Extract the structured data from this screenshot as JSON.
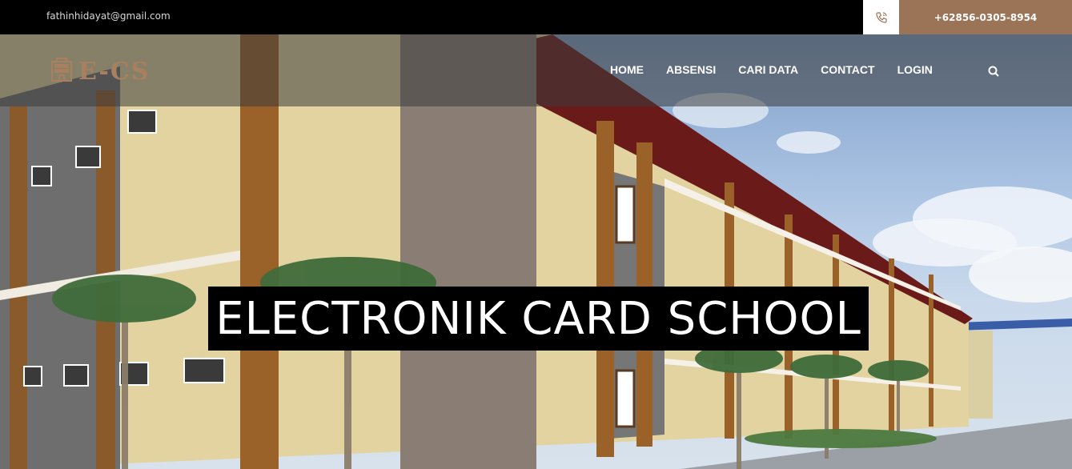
{
  "topbar": {
    "email": "fathinhidayat@gmail.com",
    "phone": "+62856-0305-8954",
    "phone_icon": "phone-icon"
  },
  "brand": {
    "logo_text": "E-CS",
    "logo_icon": "building-icon",
    "color": "#a9805f"
  },
  "nav": {
    "items": [
      "HOME",
      "ABSENSI",
      "CARI DATA",
      "CONTACT",
      "LOGIN"
    ],
    "search_icon": "search-icon"
  },
  "hero": {
    "title": "ELECTRONIK CARD SCHOOL"
  },
  "colors": {
    "accent": "#9b7457",
    "topbar": "#000000"
  }
}
